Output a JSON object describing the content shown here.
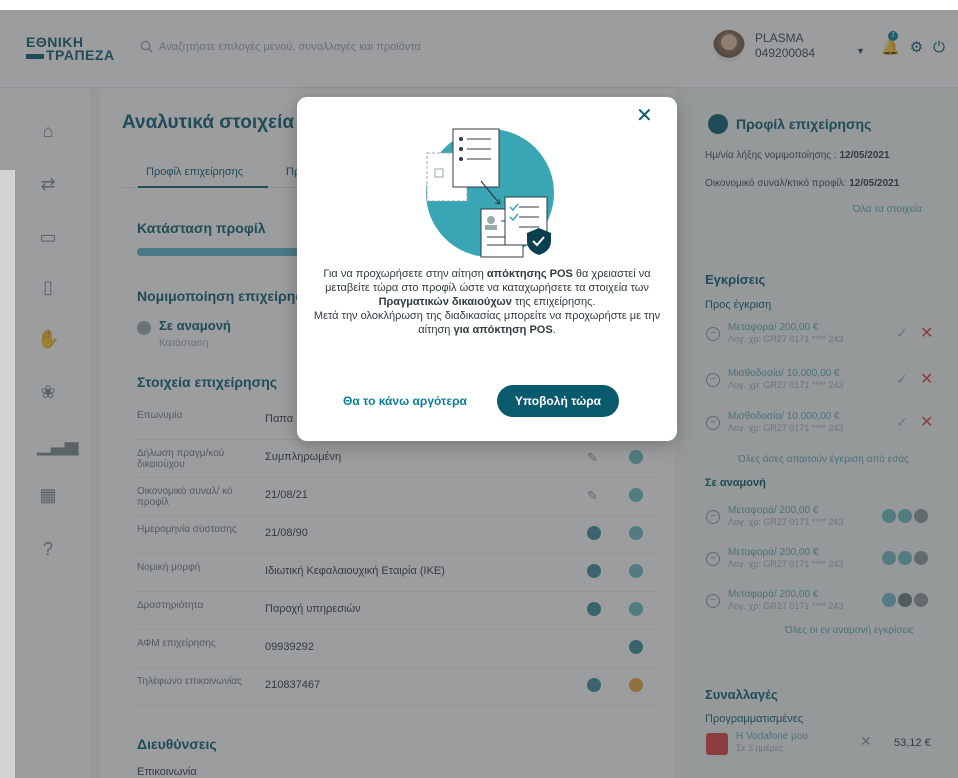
{
  "header": {
    "logo_line1": "ΕΘΝΙΚΗ",
    "logo_line2": "ΤΡΑΠΕΖΑ",
    "search_placeholder": "Αναζητήστε επιλογές μενού, συναλλαγές και προϊόντα",
    "user_name": "PLASMA",
    "user_code": "049200084",
    "notification_count": "1"
  },
  "main": {
    "title": "Αναλυτικά στοιχεία",
    "tab1": "Προφίλ επιχείρησης",
    "tab2": "Πρ",
    "profile_status_title": "Κατάσταση προφίλ",
    "profile_progress": 0.35,
    "legalization_title": "Νομιμοποίηση επιχείρησ",
    "status_value": "Σε αναμονή",
    "status_label": "Κατάσταση",
    "details_title": "Στοιχεία επιχείρησης",
    "addresses_title": "Διευθύνσεις",
    "contact_label": "Επικοινωνία",
    "rows": [
      {
        "k": "Επωνυμία",
        "v": "Παπα"
      },
      {
        "k": "Δήλωση πραγμ/κού δικαιούχου",
        "v": "Συμπληρωμένη"
      },
      {
        "k": "Οικονομικό συναλ/ κό προφίλ",
        "v": "21/08/21"
      },
      {
        "k": "Ημερομηνία σύστασης",
        "v": "21/08/90"
      },
      {
        "k": "Νομική μορφή",
        "v": "Ιδιωτική Κεφαλαιουχική Εταιρία (ΙΚΕ)"
      },
      {
        "k": "Δραστηριότητα",
        "v": "Παροχή υπηρεσιών"
      },
      {
        "k": "ΑΦΜ επιχείρησης",
        "v": "09939292"
      },
      {
        "k": "Τηλέφωνο επικοινωνίας",
        "v": "210837467"
      }
    ]
  },
  "right": {
    "profile_title": "Προφίλ επιχείρησης",
    "legal_expiry_label": "Ημ/νία λήξης νομιμοποίησης :",
    "legal_expiry": "12/05/2021",
    "fin_profile_label": "Οικονομικό συναλ/κτικό προφίλ:",
    "fin_profile": "12/05/2021",
    "all_details": "Όλα τα στοιχεία",
    "approvals_title": "Εγκρίσεις",
    "pending_approval": "Προς έγκριση",
    "approvals": [
      {
        "t": "Μεταφορά/ 200,00 €",
        "s": "Λογ. χρ: GR27 0171 **** 243"
      },
      {
        "t": "Μισθοδοσία/ 10.000,00 €",
        "s": "Λογ. χρ: GR27 0171 **** 243"
      },
      {
        "t": "Μισθοδοσία/ 10.000,00 €",
        "s": "Λογ. χρ: GR27 0171 **** 243"
      }
    ],
    "all_approvals": "Όλες όσες απαιτούν έγκριση από εσάς",
    "waiting_title": "Σε αναμονή",
    "waiting": [
      {
        "t": "Μεταφορά/ 200,00 €",
        "s": "Λογ. χρ: GR27 0171 **** 243"
      },
      {
        "t": "Μεταφορά/ 200,00 €",
        "s": "Λογ. χρ: GR27 0171 **** 243"
      },
      {
        "t": "Μεταφορά/ 200,00 €",
        "s": "Λογ. χρ: GR27 0171 **** 243"
      }
    ],
    "all_waiting": "Όλες οι εν αναμονή εγκρίσεις",
    "tx_title": "Συναλλαγές",
    "scheduled": "Προγραμματισμένες",
    "tx_name": "Η Vodafone μου",
    "tx_when": "Σε 3 ημέρες",
    "tx_amount": "53,12 €"
  },
  "modal": {
    "line1a": "Για να προχωρήσετε στην αίτηση ",
    "line1b": "απόκτησης POS",
    "line1c": " θα χρειαστεί να μεταβείτε τώρα στο προφίλ ώστε να καταχωρήσετε τα στοιχεία των ",
    "line1d": "Πραγματικών δικαιούχων",
    "line1e": " της επιχείρησης.",
    "line2a": "Μετά την ολοκλήρωση της διαδικασίας μπορείτε να προχωρήστε με την αίτηση ",
    "line2b": "για απόκτηση POS",
    "line2c": ".",
    "later": "Θα το κάνω αργότερα",
    "submit": "Υποβολή τώρα"
  }
}
